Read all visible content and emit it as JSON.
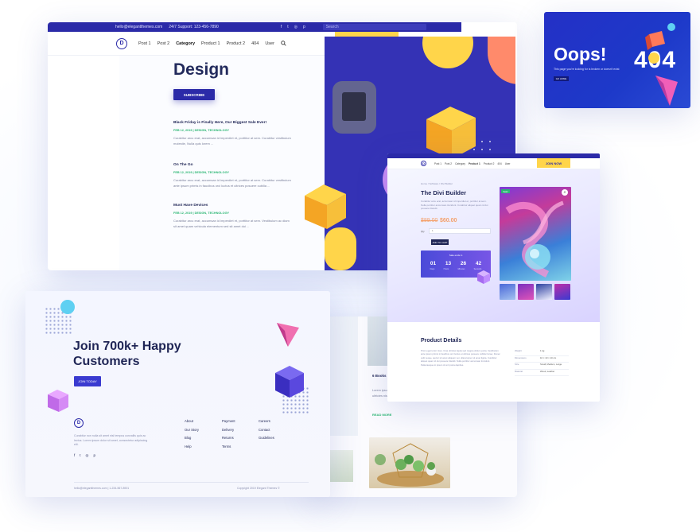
{
  "blog": {
    "topbar": {
      "email": "hello@elegantthemes.com",
      "support": "24/7 Support: 123-456-7890",
      "search_placeholder": "Search"
    },
    "nav": {
      "logo": "D",
      "items": [
        "Post 1",
        "Post 2",
        "Category",
        "Product 1",
        "Product 2",
        "404",
        "User"
      ],
      "join_label": "JOIN NOW"
    },
    "heading": "Design",
    "subscribe_label": "SUBSCRIBE",
    "posts": [
      {
        "title": "Black Friday is Finally Here, Our Biggest Sale Ever!",
        "meta": "FEB 12, 2019 | DESIGN, TECHNOLOGY",
        "excerpt": "Curabitur arcu erat, accumsan id imperdiet et, porttitor at sem. Curabitur vestibulum molestie, Nulla quis lorem ..."
      },
      {
        "title": "On The Go",
        "meta": "FEB 12, 2019 | DESIGN, TECHNOLOGY",
        "excerpt": "Curabitur arcu erat, accumsan id imperdiet et, porttitor at sem. Curabitur vestibulum ante ipsum primis in faucibus orci luctus et ultrices posuere cubilia ..."
      },
      {
        "title": "Must Have Devices",
        "meta": "FEB 12, 2019 | DESIGN, TECHNOLOGY",
        "excerpt": "Curabitur arcu erat, accumsan id imperdiet et, porttitor at sem. Vestibulum ac diam sit amet quam vehicula elementum sed sit amet dui ..."
      }
    ]
  },
  "oops": {
    "title": "Oops!",
    "subtitle": "This page you're looking for is broken or doesn't exist",
    "button": "GO HOME",
    "code": "404"
  },
  "product": {
    "join_label": "JOIN NOW",
    "nav_items": [
      "Post 1",
      "Post 2",
      "Category",
      "Product 1",
      "Product 2",
      "404",
      "User"
    ],
    "breadcrumb": "Home / Software / Divi Builder",
    "name": "The Divi Builder",
    "description": "Curabitur arcu erat, accumsan id imperdiet et, porttitor at sem. Nulla porttitor accumsan tincidunt. Curabitur aliquet quam id dui posuere blandit.",
    "price_old": "$89.00",
    "price_new": "$60.00",
    "qty_label": "Qty",
    "qty_value": "1",
    "add_label": "ADD TO CART",
    "badge": "Sale!",
    "countdown": {
      "label": "Sale ends in",
      "values": [
        "01",
        "13",
        "26",
        "42"
      ],
      "units": [
        "Days",
        "Hours",
        "Minutes",
        "Seconds"
      ]
    },
    "details_title": "Product Details",
    "details_text": "Proin eget tortor risus. Cras ultricies ligula sed magna dictum porta. Vestibulum ante ipsum primis in faucibus orci luctus et ultrices posuere cubilia Curae; Donec velit neque, auctor sit amet aliquam vel, ullamcorper sit amet ligula. Curabitur aliquet quam id dui posuere blandit. Nulla porttitor accumsan tincidunt. Pellentesque in ipsum id orci porta dapibus.",
    "specs": [
      {
        "k": "Weight",
        "v": "1 kg"
      },
      {
        "k": "Dimensions",
        "v": "10 × 10 × 10 cm"
      },
      {
        "k": "Size",
        "v": "Small, Medium, Large"
      },
      {
        "k": "Material",
        "v": "Wood, Leather"
      }
    ]
  },
  "bg_post": {
    "title": "6 Books",
    "excerpt_1": "Lorem ipsum dolor sit amet, consectetur adipiscing elit.",
    "excerpt_2": "ultricies nisi vel auctor. Proin eget tortor risus. Phasellus.",
    "read_more": "READ MORE"
  },
  "join_card": {
    "heading": "Join 700k+ Happy Customers",
    "button": "JOIN TODAY",
    "logo": "D",
    "footer_desc": "Curabitur non nulla sit amet nisl tempus convallis quis ac lectus. Lorem ipsum dolor sit amet, consectetur adipiscing elit.",
    "col1": [
      "About",
      "Our Story",
      "Blog",
      "Help"
    ],
    "col2": [
      "Payment",
      "Delivery",
      "Returns",
      "Terms"
    ],
    "col3": [
      "Careers",
      "Contact",
      "Guidelines"
    ],
    "contact": "hello@elegantthemes.com  |  1-234-567-8901",
    "copyright": "Copyright 2019 Elegant Themes ©"
  },
  "colors": {
    "brand": "#2b2aa8",
    "accent_yellow": "#ffd54a",
    "accent_green": "#2bb673",
    "accent_orange": "#f4a06b"
  }
}
